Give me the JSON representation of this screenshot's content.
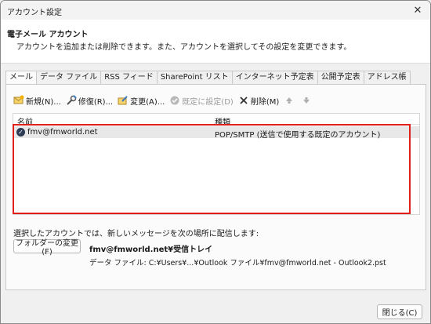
{
  "window": {
    "title": "アカウント設定",
    "close_glyph": "✕"
  },
  "header": {
    "title": "電子メール アカウント",
    "description": "アカウントを追加または削除できます。また、アカウントを選択してその設定を変更できます。"
  },
  "tabs": [
    {
      "label": "メール",
      "active": true
    },
    {
      "label": "データ ファイル",
      "active": false
    },
    {
      "label": "RSS フィード",
      "active": false
    },
    {
      "label": "SharePoint リスト",
      "active": false
    },
    {
      "label": "インターネット予定表",
      "active": false
    },
    {
      "label": "公開予定表",
      "active": false
    },
    {
      "label": "アドレス帳",
      "active": false
    }
  ],
  "toolbar": {
    "new_label": "新規(N)...",
    "repair_label": "修復(R)...",
    "change_label": "変更(A)...",
    "default_label": "既定に設定(D)",
    "delete_label": "削除(M)"
  },
  "account_list": {
    "col_name": "名前",
    "col_type": "種類",
    "rows": [
      {
        "name": "fmv@fmworld.net",
        "type": "POP/SMTP (送信で使用する既定のアカウント)"
      }
    ]
  },
  "delivery": {
    "label": "選択したアカウントでは、新しいメッセージを次の場所に配信します:",
    "change_folder_label": "フォルダーの変更(F)",
    "folder": "fmv@fmworld.net¥受信トレイ",
    "data_file": "データ ファイル: C:¥Users¥...¥Outlook ファイル¥fmv@fmworld.net - Outlook2.pst"
  },
  "footer": {
    "close_label": "閉じる(C)"
  },
  "colors": {
    "highlight": "#e0201a",
    "selected_row": "#e8e8e8"
  }
}
